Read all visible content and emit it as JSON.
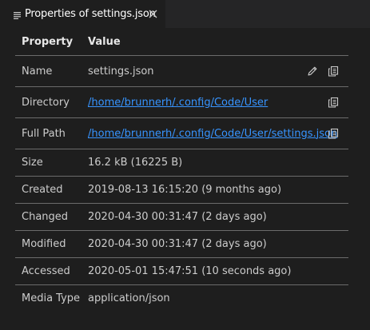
{
  "tab": {
    "title": "Properties of settings.json",
    "icon": "list-icon",
    "close_icon": "close-icon"
  },
  "table": {
    "headers": [
      "Property",
      "Value"
    ],
    "rows": [
      {
        "key": "Name",
        "value": "settings.json",
        "actions": [
          "edit-icon",
          "copy-icon"
        ]
      },
      {
        "key": "Directory",
        "value": "/home/brunnerh/.config/Code/User",
        "link": true,
        "actions": [
          "copy-icon"
        ]
      },
      {
        "key": "Full Path",
        "value": "/home/brunnerh/.config/Code/User/settings.json",
        "link": true,
        "actions": [
          "copy-icon"
        ]
      },
      {
        "key": "Size",
        "value": "16.2 kB (16225 B)"
      },
      {
        "key": "Created",
        "value": "2019-08-13 16:15:20 (9 months ago)"
      },
      {
        "key": "Changed",
        "value": "2020-04-30 00:31:47 (2 days ago)"
      },
      {
        "key": "Modified",
        "value": "2020-04-30 00:31:47 (2 days ago)"
      },
      {
        "key": "Accessed",
        "value": "2020-05-01 15:47:51 (10 seconds ago)"
      },
      {
        "key": "Media Type",
        "value": "application/json"
      }
    ]
  },
  "colors": {
    "background": "#1e1e1e",
    "tabbar": "#252526",
    "link": "#3794ff",
    "text": "#cccccc",
    "divider": "#6b6b6b"
  }
}
